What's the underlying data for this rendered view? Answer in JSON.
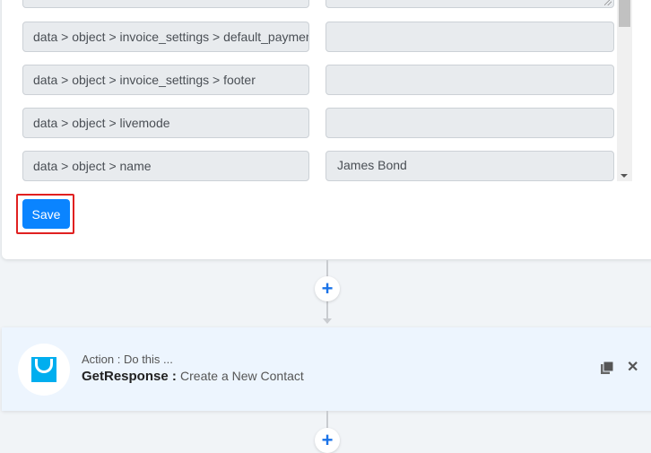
{
  "mapping_rows": [
    {
      "key": "",
      "value": ""
    },
    {
      "key": "data > object > invoice_settings > default_payment_method",
      "value": ""
    },
    {
      "key": "data > object > invoice_settings > footer",
      "value": ""
    },
    {
      "key": "data > object > livemode",
      "value": ""
    },
    {
      "key": "data > object > name",
      "value": "James Bond"
    }
  ],
  "save_label": "Save",
  "add_step_label": "+",
  "action": {
    "subtitle": "Action : Do this ...",
    "app": "GetResponse :",
    "event": "Create a New Contact",
    "close_label": "✕"
  },
  "colors": {
    "primary": "#0a84ff",
    "highlight": "#e02020",
    "getresponse": "#00aeef"
  }
}
